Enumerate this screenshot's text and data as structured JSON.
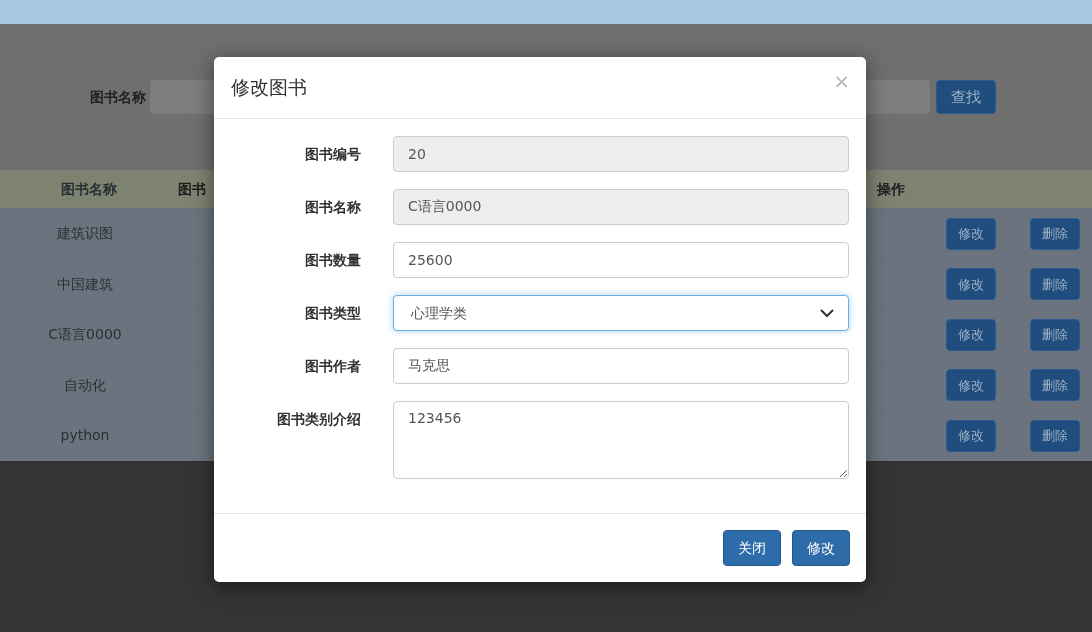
{
  "search": {
    "label": "图书名称",
    "button": "查找"
  },
  "table": {
    "columns": [
      "图书名称",
      "图书",
      "操作"
    ],
    "rows": [
      {
        "name": "建筑识图",
        "actions": [
          "修改",
          "删除"
        ]
      },
      {
        "name": "中国建筑",
        "actions": [
          "修改",
          "删除"
        ]
      },
      {
        "name": "C语言0000",
        "actions": [
          "修改",
          "删除"
        ]
      },
      {
        "name": "自动化",
        "actions": [
          "修改",
          "删除"
        ]
      },
      {
        "name": "python",
        "actions": [
          "修改",
          "删除"
        ]
      }
    ]
  },
  "modal": {
    "title": "修改图书",
    "close": "×",
    "fields": [
      {
        "kind": "input",
        "label": "图书编号",
        "value": "20",
        "disabled": true,
        "focused": false
      },
      {
        "kind": "input",
        "label": "图书名称",
        "value": "C语言0000",
        "disabled": true,
        "focused": false
      },
      {
        "kind": "input",
        "label": "图书数量",
        "value": "25600",
        "disabled": false,
        "focused": false
      },
      {
        "kind": "select",
        "label": "图书类型",
        "value": "心理学类",
        "disabled": false,
        "focused": true
      },
      {
        "kind": "input",
        "label": "图书作者",
        "value": "马克思",
        "disabled": false,
        "focused": false
      },
      {
        "kind": "textarea",
        "label": "图书类别介绍",
        "value": "123456",
        "disabled": false,
        "focused": false
      }
    ],
    "buttons": [
      "关闭",
      "修改"
    ]
  }
}
